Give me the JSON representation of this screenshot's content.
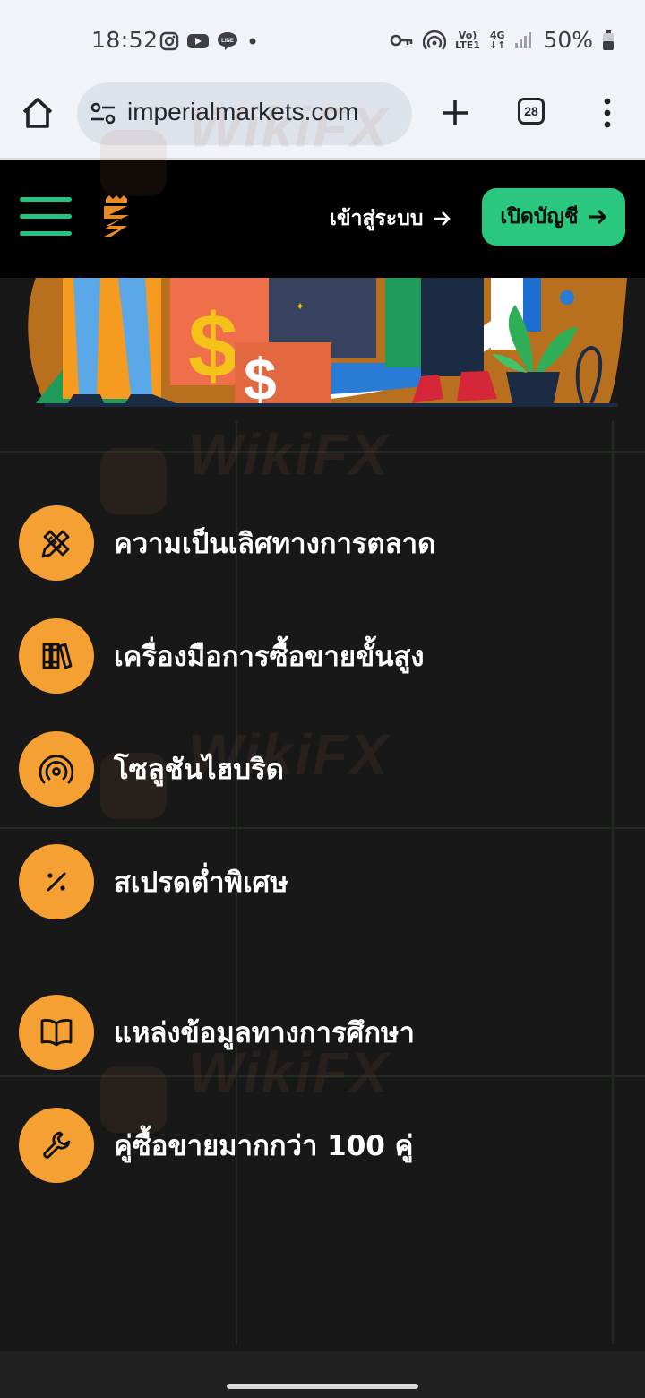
{
  "status_bar": {
    "time": "18:52",
    "network_top": "Vo)",
    "network_bottom": "LTE1",
    "network_type": "4G",
    "battery": "50%",
    "notification_icons": [
      "instagram-icon",
      "youtube-icon",
      "line-icon",
      "dot-icon"
    ],
    "system_icons": [
      "key-icon",
      "hotspot-icon",
      "signal-icon",
      "battery-icon"
    ]
  },
  "browser": {
    "url": "imperialmarkets.com",
    "tab_count": "28"
  },
  "header": {
    "login_label": "เข้าสู่ระบบ",
    "open_account_label": "เปิดบัญชี",
    "accent_color": "#2ac77f"
  },
  "features": [
    {
      "label": "ความเป็นเลิศทางการตลาด",
      "icon": "pencil-ruler-icon"
    },
    {
      "label": "เครื่องมือการซื้อขายขั้นสูง",
      "icon": "books-icon"
    },
    {
      "label": "โซลูชันไฮบริด",
      "icon": "broadcast-icon"
    },
    {
      "label": "สเปรดต่ำพิเศษ",
      "icon": "percent-icon"
    },
    {
      "label": "แหล่งข้อมูลทางการศึกษา",
      "icon": "open-book-icon"
    },
    {
      "label": "คู่ซื้อขายมากกว่า 100 คู่",
      "icon": "wrench-icon"
    }
  ],
  "colors": {
    "feature_icon_bg": "#f5a033",
    "page_bg": "#181818"
  },
  "watermark": "WikiFX"
}
